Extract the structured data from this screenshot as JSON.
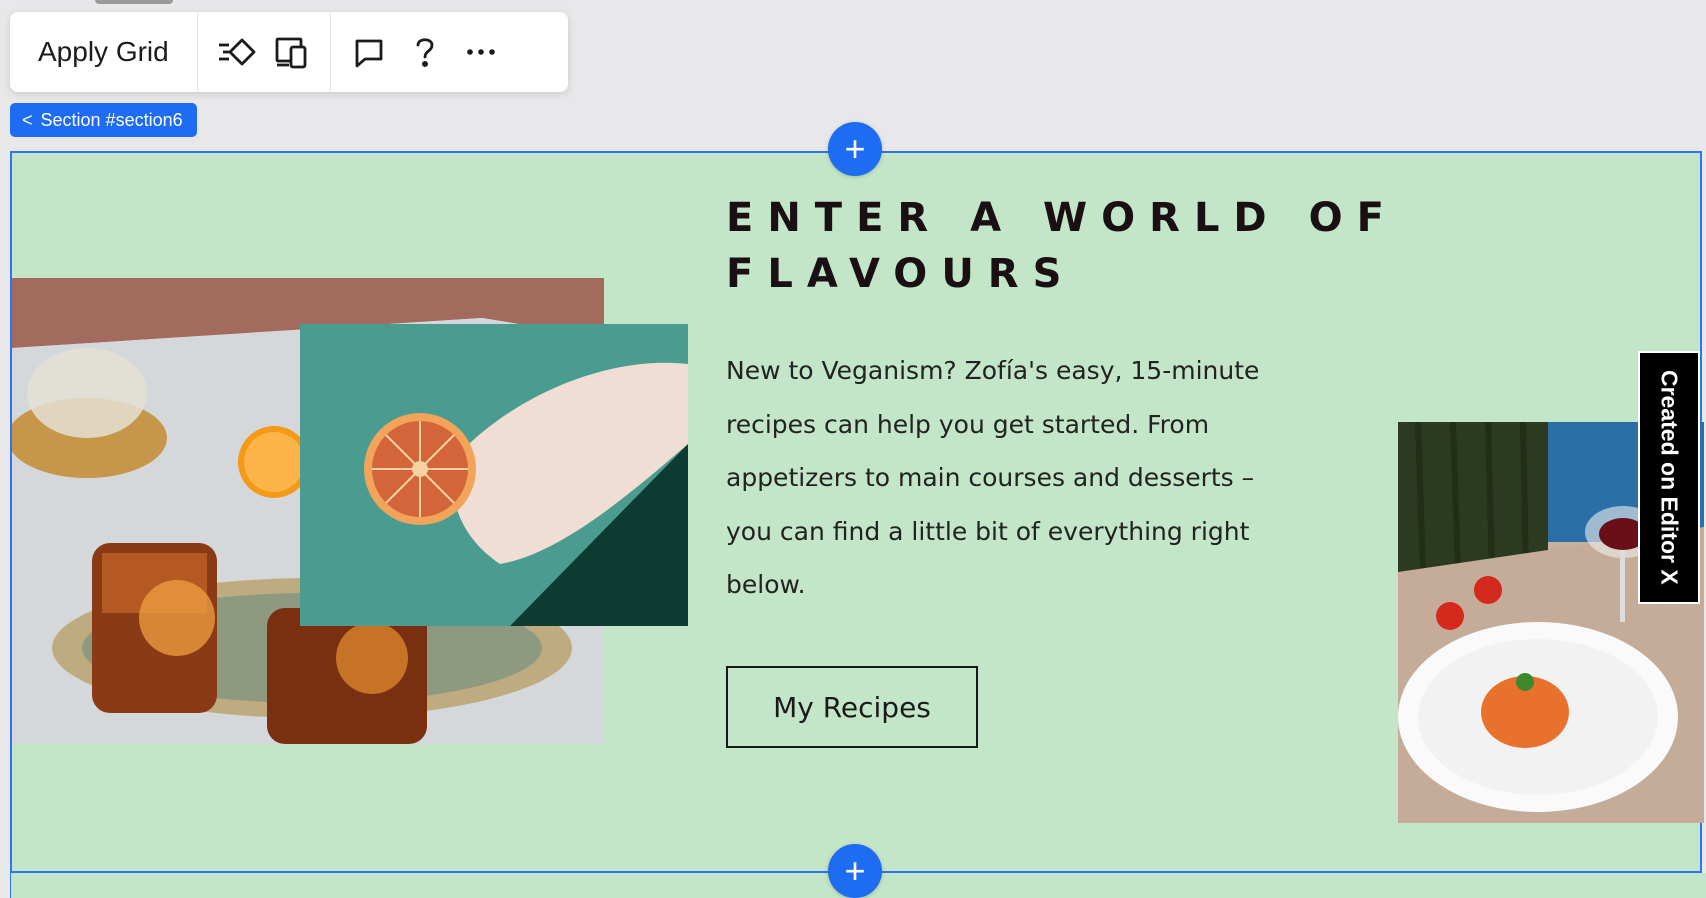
{
  "toolbar": {
    "apply_grid_label": "Apply Grid",
    "icons": [
      "animation-icon",
      "responsive-devices-icon",
      "comment-icon",
      "help-icon",
      "more-icon"
    ]
  },
  "section_tag": {
    "chevron": "<",
    "label": "Section #section6"
  },
  "add_section": {
    "symbol": "+"
  },
  "content": {
    "heading": "ENTER A WORLD OF FLAVOURS",
    "body": "New to Veganism? Zofía's easy, 15-minute recipes can help you get started. From appetizers to main courses and desserts – you can find a little bit of everything right below.",
    "button_label": "My Recipes"
  },
  "badge": {
    "label": "Created on Editor X"
  },
  "colors": {
    "section_bg": "#c4e6c8",
    "selection_blue": "#1d6cf2",
    "canvas_bg": "#e8e7e9"
  }
}
